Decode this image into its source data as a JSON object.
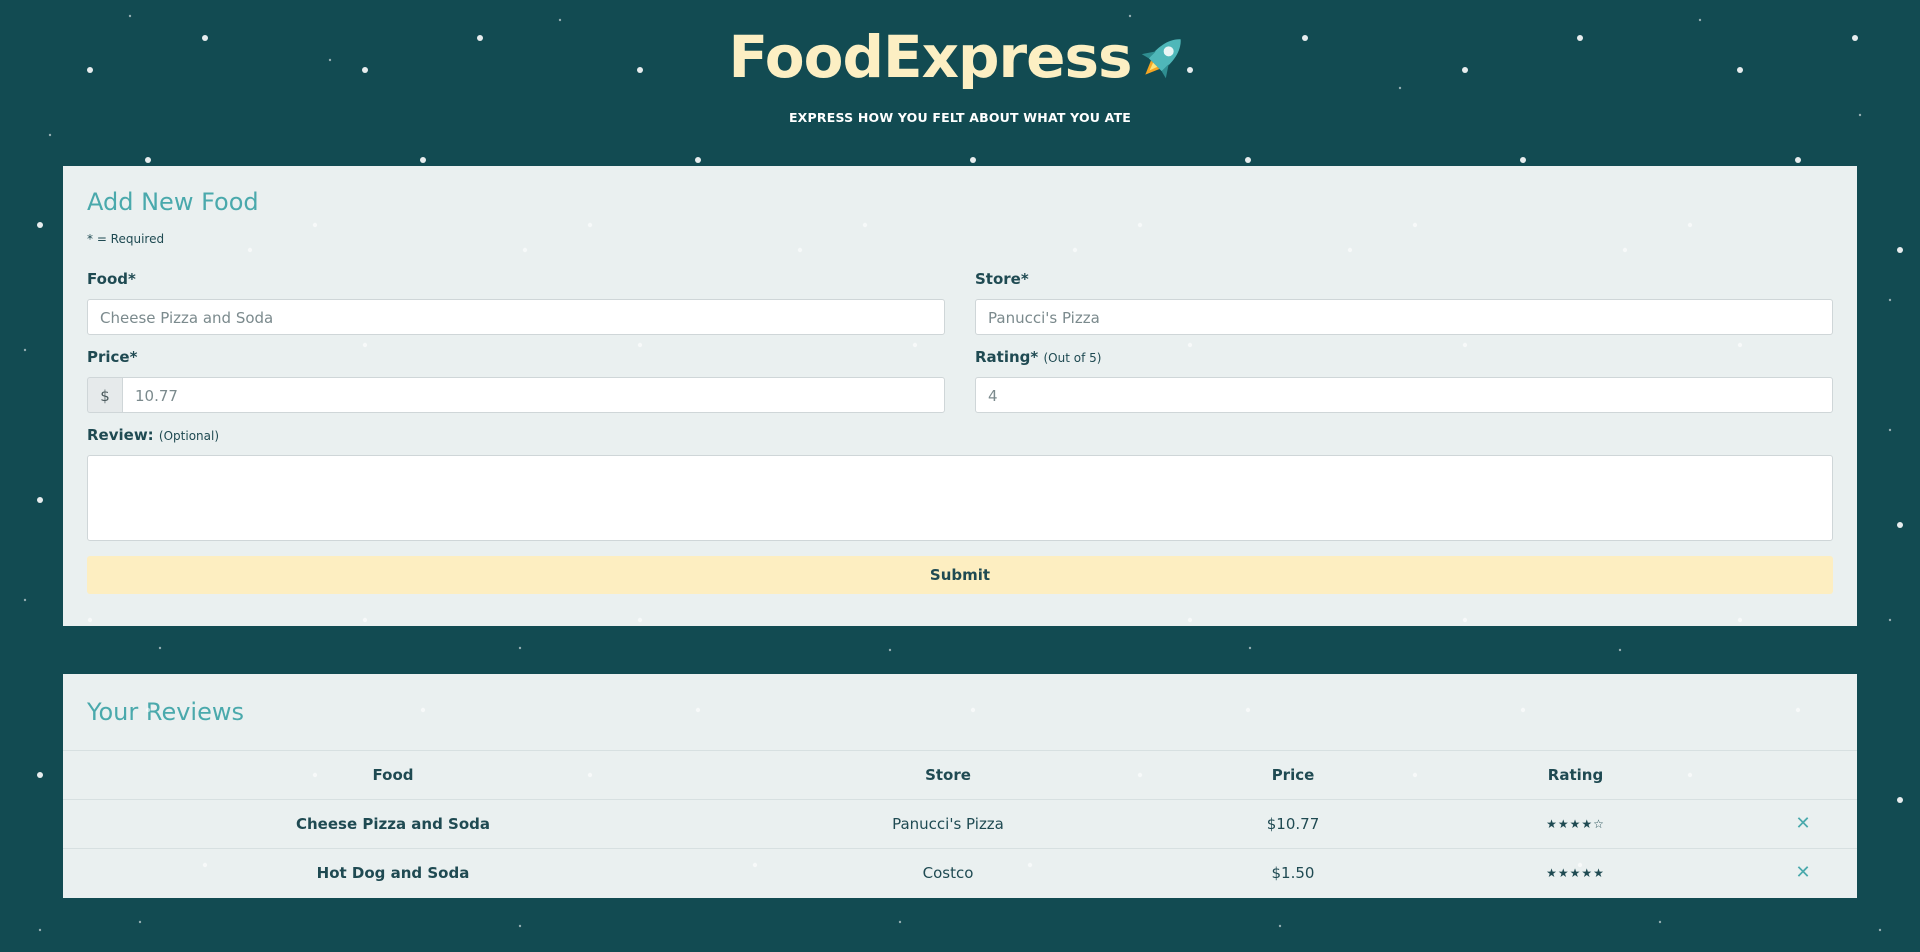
{
  "app": {
    "title": "FoodExpress",
    "tagline": "EXPRESS HOW YOU FELT ABOUT WHAT YOU ATE"
  },
  "form": {
    "title": "Add New Food",
    "required_note": "* = Required",
    "food": {
      "label": "Food*",
      "value": "Cheese Pizza and Soda"
    },
    "store": {
      "label": "Store*",
      "value": "Panucci's Pizza"
    },
    "price": {
      "label": "Price*",
      "prefix": "$",
      "value": "10.77"
    },
    "rating": {
      "label": "Rating*",
      "hint": "(Out of 5)",
      "value": "4"
    },
    "review": {
      "label": "Review:",
      "hint": "(Optional)",
      "value": ""
    },
    "submit_label": "Submit"
  },
  "reviews": {
    "title": "Your Reviews",
    "columns": [
      "Food",
      "Store",
      "Price",
      "Rating"
    ],
    "rows": [
      {
        "food": "Cheese Pizza and Soda",
        "store": "Panucci's Pizza",
        "price": "$10.77",
        "rating": 4,
        "rating_stars": "★★★★☆",
        "delete": "✕"
      },
      {
        "food": "Hot Dog and Soda",
        "store": "Costco",
        "price": "$1.50",
        "rating": 5,
        "rating_stars": "★★★★★",
        "delete": "✕"
      }
    ]
  },
  "colors": {
    "background": "#124b52",
    "panel": "#eaf0f0",
    "accent": "#4aa9ac",
    "title": "#fcefc3",
    "submit": "#fdeec1",
    "text": "#1f4a52"
  }
}
